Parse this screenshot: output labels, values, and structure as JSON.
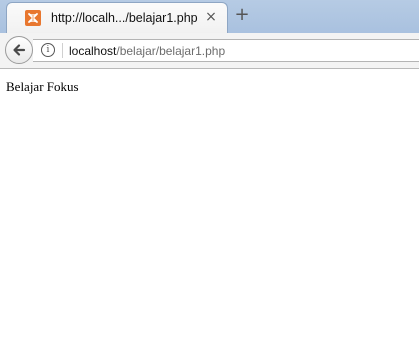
{
  "tab": {
    "title": "http://localh.../belajar1.php",
    "favicon": "xampp-icon",
    "close_label": "×",
    "new_tab_label": "+"
  },
  "navbar": {
    "back_icon": "back-arrow-icon",
    "info_icon_label": "i",
    "url_host": "localhost",
    "url_path": "/belajar/belajar1.php"
  },
  "page": {
    "text": "Belajar Fokus"
  },
  "colors": {
    "tabstrip": "#b6cbe4",
    "favicon": "#e8772f"
  }
}
